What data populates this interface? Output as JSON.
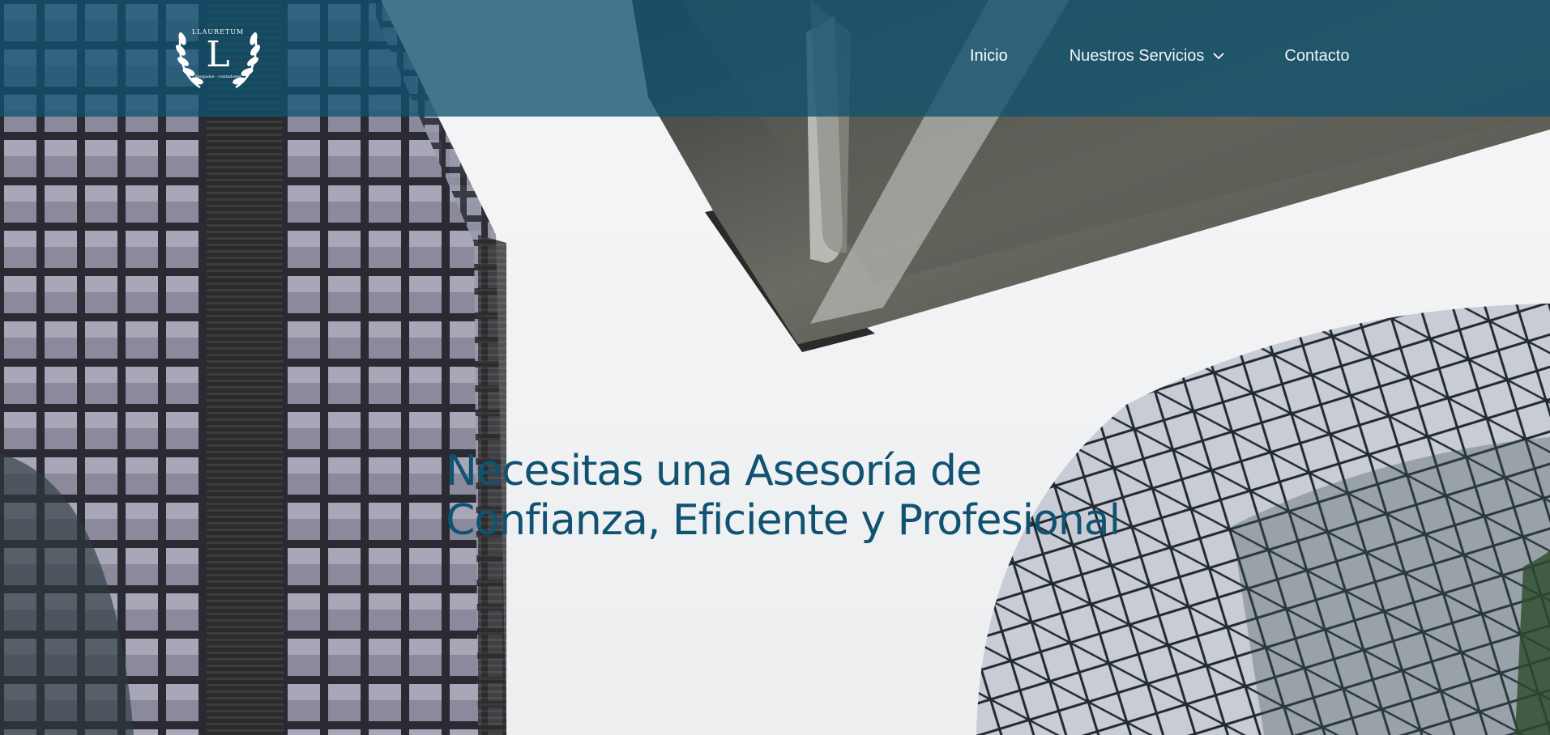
{
  "header": {
    "logo": {
      "text": "LLAURETUM",
      "initial": "L",
      "tagline": "abogados · contadores"
    },
    "nav": [
      {
        "label": "Inicio",
        "active": true
      },
      {
        "label": "Nuestros Servicios",
        "has_dropdown": true
      },
      {
        "label": "Contacto"
      }
    ]
  },
  "hero": {
    "title_line1": "Necesitas una Asesoría de",
    "title_line2": "Confianza, Eficiente y Profesional"
  },
  "colors": {
    "header_bg": "#105270",
    "title": "#0f5272",
    "nav_text": "#ffffff"
  }
}
